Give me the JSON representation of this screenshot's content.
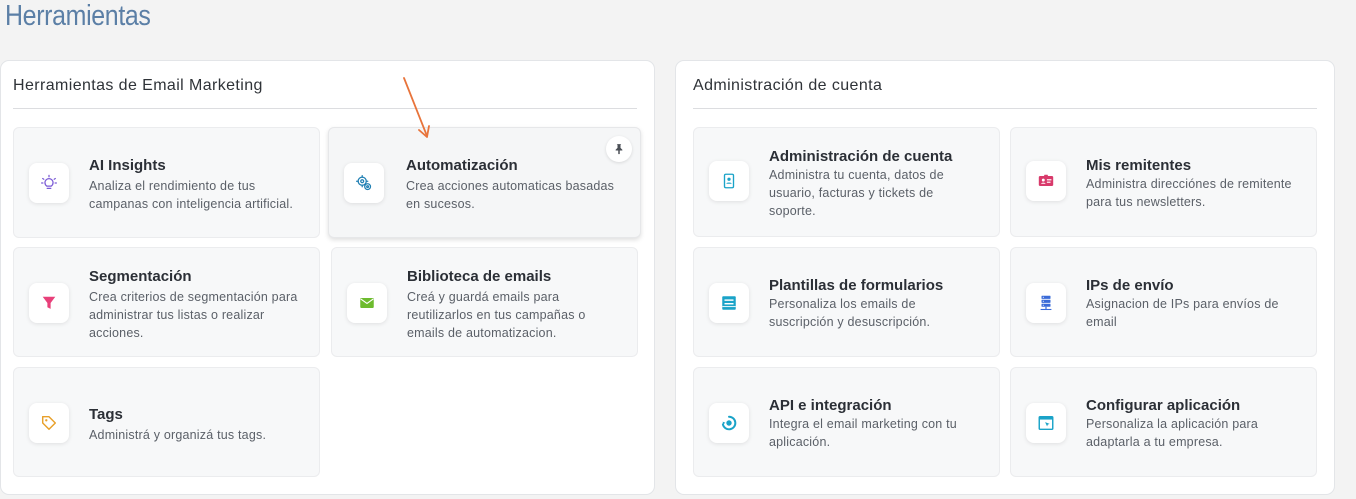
{
  "page": {
    "title": "Herramientas"
  },
  "email_tools": {
    "title": "Herramientas de Email Marketing",
    "cards": [
      {
        "title": "AI Insights",
        "desc": [
          "Analiza el rendimiento de tus",
          "campanas con inteligencia artificial."
        ],
        "icon": "lightbulb-icon",
        "color": "#7b5bd6"
      },
      {
        "title": "Automatización",
        "desc": [
          "Crea acciones automaticas basadas",
          "en sucesos."
        ],
        "icon": "gears-icon",
        "color": "#1f7fb3"
      },
      {
        "title": "Segmentación",
        "desc": [
          "Crea criterios de segmentación para",
          "administrar tus listas o realizar",
          "acciones."
        ],
        "icon": "funnel-icon",
        "color": "#e8407a"
      },
      {
        "title": "Biblioteca de emails",
        "desc": [
          "Creá y guardá emails para",
          "reutilizarlos en tus campañas o",
          "emails de automatizacion."
        ],
        "icon": "envelope-icon",
        "color": "#6dbb2e"
      },
      {
        "title": "Tags",
        "desc": [
          "Administrá y organizá tus tags."
        ],
        "icon": "tag-icon",
        "color": "#e8a02a"
      }
    ]
  },
  "account_admin": {
    "title": "Administración de cuenta",
    "cards": [
      {
        "title": "Administración de cuenta",
        "desc": [
          "Administra tu cuenta, datos de",
          "usuario, facturas y tickets de",
          "soporte."
        ],
        "icon": "user-device-icon",
        "color": "#1aa3c8"
      },
      {
        "title": "Mis remitentes",
        "desc": [
          "Administra direcciónes de remitente",
          "para tus newsletters."
        ],
        "icon": "id-card-icon",
        "color": "#d83a6b"
      },
      {
        "title": "Plantillas de formularios",
        "desc": [
          "Personaliza los emails de",
          "suscripción y desuscripción."
        ],
        "icon": "form-template-icon",
        "color": "#1aa3c8"
      },
      {
        "title": "IPs de envío",
        "desc": [
          "Asignacion de IPs para envíos de",
          "email"
        ],
        "icon": "server-icon",
        "color": "#3a6bd8"
      },
      {
        "title": "API e integración",
        "desc": [
          "Integra el email marketing con tu",
          "aplicación."
        ],
        "icon": "api-icon",
        "color": "#1aa3c8"
      },
      {
        "title": "Configurar aplicación",
        "desc": [
          "Personaliza la aplicación para",
          "adaptarla a tu empresa."
        ],
        "icon": "app-window-icon",
        "color": "#1aa3c8"
      }
    ]
  },
  "annotation": {
    "arrow_color": "#e8743b"
  }
}
